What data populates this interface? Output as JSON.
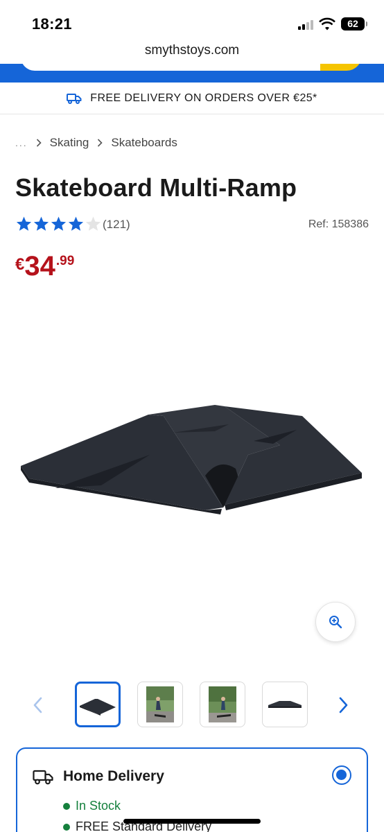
{
  "status_bar": {
    "time": "18:21",
    "battery": "62"
  },
  "browser": {
    "url": "smythstoys.com"
  },
  "banner": {
    "text": "FREE DELIVERY ON ORDERS OVER €25*"
  },
  "breadcrumb": {
    "ellipsis": "...",
    "items": [
      "Skating",
      "Skateboards"
    ]
  },
  "product": {
    "title": "Skateboard Multi-Ramp",
    "rating": 4,
    "rating_max": 5,
    "review_count": "(121)",
    "ref": "Ref: 158386",
    "price": {
      "currency": "€",
      "whole": "34",
      "cents": ".99"
    }
  },
  "gallery": {
    "thumbnail_count": 4,
    "active_index": 0
  },
  "delivery": {
    "title": "Home Delivery",
    "stock_status": "In Stock",
    "shipping": "FREE Standard Delivery"
  },
  "colors": {
    "brand_blue": "#1565d8",
    "price_red": "#b5121b",
    "stock_green": "#15803d",
    "accent_yellow": "#f5c400"
  }
}
